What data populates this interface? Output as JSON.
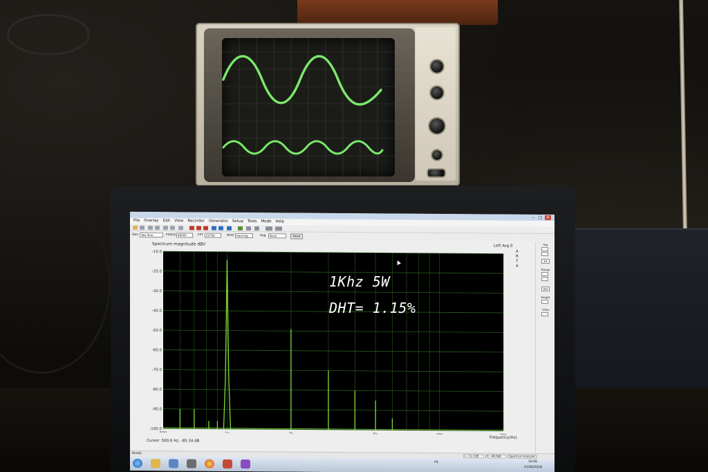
{
  "annotation": {
    "line1": "1Khz  5W",
    "line2": "DHT= 1.15%"
  },
  "app": {
    "menu": [
      "File",
      "Overlay",
      "Edit",
      "View",
      "Recorder",
      "Generator",
      "Setup",
      "Tools",
      "Mode",
      "Help"
    ],
    "settings": {
      "gen_label": "Gen",
      "gen_value": "Two Sine",
      "fs_label": "FS(KS)",
      "fs_value": "48000",
      "fft_label": "FFT",
      "fft_value": "32768",
      "wnd_label": "Wnd",
      "wnd_value": "Hanning",
      "avg_label": "Avg",
      "avg_value": "None",
      "reset_label": "Reset"
    },
    "plot_title": "Spectrum magnitude dBV",
    "plot_right_title": "Left  Avg 0",
    "side_letters": [
      "A",
      "R",
      "T",
      "A"
    ],
    "y_ticks": [
      "-10.0",
      "-20.0",
      "-30.0",
      "-40.0",
      "-50.0",
      "-60.0",
      "-70.0",
      "-80.0",
      "-90.0",
      "-100.0"
    ],
    "x_ticks": [
      "500",
      "1k",
      "2k",
      "5k",
      "10k",
      "20k"
    ],
    "x_axis_label": "Frequency(Hz)",
    "cursor_readout": "Cursor:   500.6 Hz,  -85.34 dB",
    "side_panel": [
      "Top",
      "Fit",
      "Range",
      "Set",
      "Height",
      "Y/Div"
    ],
    "status_ready": "Ready",
    "status_left": "L: -51.3dB",
    "status_right": "R: -48.6dB",
    "status_mode": "Spectrum Analyzer",
    "clock_time": "16:06",
    "clock_date": "01/06/2018",
    "tray_lang": "FR"
  },
  "chart_data": {
    "type": "line",
    "title": "Spectrum magnitude dBV",
    "xlabel": "Frequency(Hz)",
    "ylabel": "",
    "xscale": "log",
    "xlim": [
      500,
      20000
    ],
    "ylim": [
      -100,
      -10
    ],
    "grid": true,
    "series": [
      {
        "peaks": [
          {
            "x": 600,
            "y": -90
          },
          {
            "x": 700,
            "y": -90
          },
          {
            "x": 820,
            "y": -96
          },
          {
            "x": 900,
            "y": -96
          },
          {
            "x": 1000,
            "y": -14
          },
          {
            "x": 2000,
            "y": -49
          },
          {
            "x": 3000,
            "y": -70
          },
          {
            "x": 4000,
            "y": -80
          },
          {
            "x": 5000,
            "y": -85
          },
          {
            "x": 6000,
            "y": -94
          }
        ]
      }
    ]
  },
  "colors": {
    "trace": "#7fe03a",
    "plot_bg": "#000000",
    "grid": "#2a5c1e",
    "crt_trace": "#7be86a"
  }
}
